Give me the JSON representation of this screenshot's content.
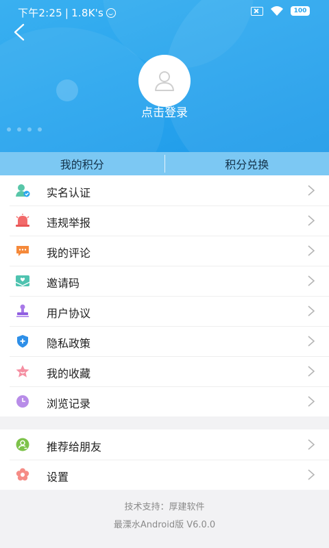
{
  "status": {
    "time": "下午2:25",
    "separator": "|",
    "speed": "1.8K's",
    "battery": "100"
  },
  "header": {
    "login_text": "点击登录"
  },
  "tabs": [
    {
      "label": "我的积分"
    },
    {
      "label": "积分兑换"
    }
  ],
  "menu_group_1": [
    {
      "label": "实名认证",
      "icon": "verified-user-icon"
    },
    {
      "label": "违规举报",
      "icon": "alarm-siren-icon"
    },
    {
      "label": "我的评论",
      "icon": "comment-bubble-icon"
    },
    {
      "label": "邀请码",
      "icon": "invite-envelope-icon"
    },
    {
      "label": "用户协议",
      "icon": "agreement-stamp-icon"
    },
    {
      "label": "隐私政策",
      "icon": "shield-plus-icon"
    },
    {
      "label": "我的收藏",
      "icon": "star-icon"
    },
    {
      "label": "浏览记录",
      "icon": "clock-icon"
    }
  ],
  "menu_group_2": [
    {
      "label": "推荐给朋友",
      "icon": "share-friend-icon"
    },
    {
      "label": "设置",
      "icon": "settings-flower-icon"
    }
  ],
  "footer": {
    "support": "技术支持：厚建软件",
    "version": "最溧水Android版 V6.0.0"
  },
  "colors": {
    "accent_blue": "#2aa6ee",
    "tab_bar": "#7cc8f3",
    "background": "#f2f2f4"
  }
}
